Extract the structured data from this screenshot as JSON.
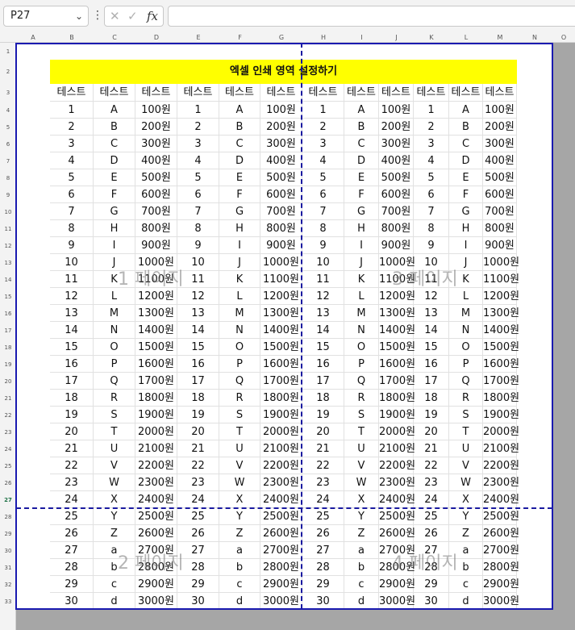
{
  "namebox": {
    "value": "P27"
  },
  "formula": {
    "value": ""
  },
  "columns": [
    "A",
    "B",
    "C",
    "D",
    "E",
    "F",
    "G",
    "H",
    "I",
    "J",
    "K",
    "L",
    "M",
    "N",
    "O"
  ],
  "title": "엑셀 인쇄 영역 설정하기",
  "header_label": "테스트",
  "watermarks": [
    "1 페이지",
    "2 페이지",
    "3 페이지",
    "4 페이지"
  ],
  "rows": [
    [
      "1",
      "A",
      "100원"
    ],
    [
      "2",
      "B",
      "200원"
    ],
    [
      "3",
      "C",
      "300원"
    ],
    [
      "4",
      "D",
      "400원"
    ],
    [
      "5",
      "E",
      "500원"
    ],
    [
      "6",
      "F",
      "600원"
    ],
    [
      "7",
      "G",
      "700원"
    ],
    [
      "8",
      "H",
      "800원"
    ],
    [
      "9",
      "I",
      "900원"
    ],
    [
      "10",
      "J",
      "1000원"
    ],
    [
      "11",
      "K",
      "1100원"
    ],
    [
      "12",
      "L",
      "1200원"
    ],
    [
      "13",
      "M",
      "1300원"
    ],
    [
      "14",
      "N",
      "1400원"
    ],
    [
      "15",
      "O",
      "1500원"
    ],
    [
      "16",
      "P",
      "1600원"
    ],
    [
      "17",
      "Q",
      "1700원"
    ],
    [
      "18",
      "R",
      "1800원"
    ],
    [
      "19",
      "S",
      "1900원"
    ],
    [
      "20",
      "T",
      "2000원"
    ],
    [
      "21",
      "U",
      "2100원"
    ],
    [
      "22",
      "V",
      "2200원"
    ],
    [
      "23",
      "W",
      "2300원"
    ],
    [
      "24",
      "X",
      "2400원"
    ],
    [
      "25",
      "Y",
      "2500원"
    ],
    [
      "26",
      "Z",
      "2600원"
    ],
    [
      "27",
      "a",
      "2700원"
    ],
    [
      "28",
      "b",
      "2800원"
    ],
    [
      "29",
      "c",
      "2900원"
    ],
    [
      "30",
      "d",
      "3000원"
    ]
  ],
  "colors": {
    "highlight": "#ffff00",
    "page_break": "#1a1aa0"
  }
}
